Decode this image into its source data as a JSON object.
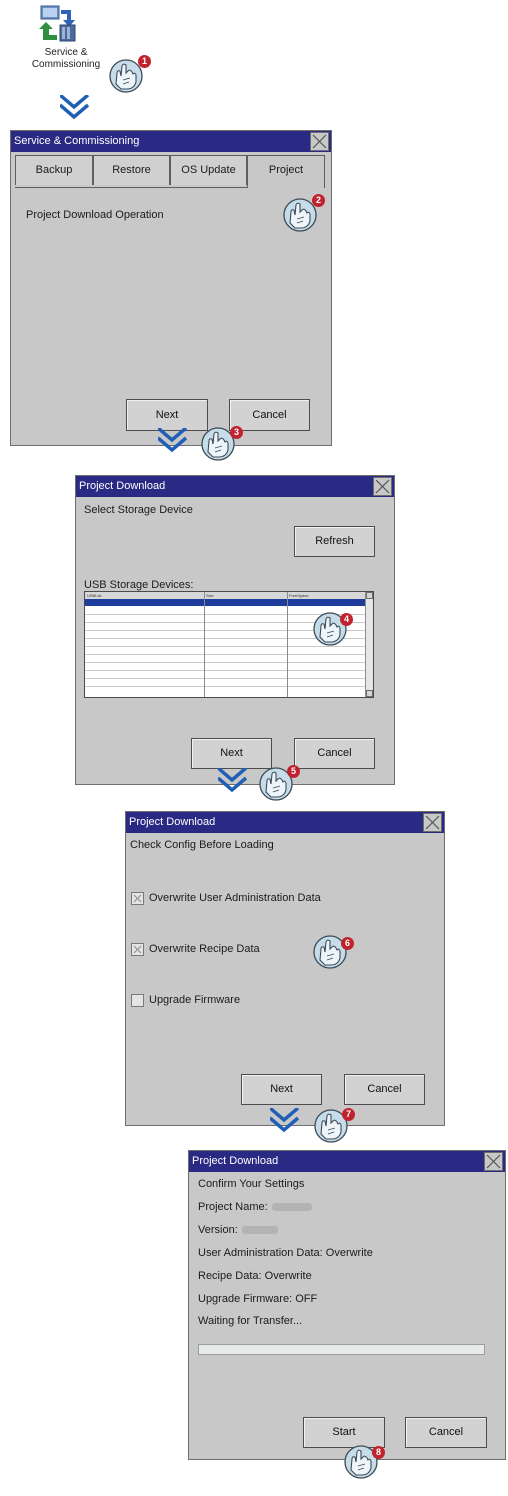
{
  "launcher": {
    "label_line1": "Service &",
    "label_line2": "Commissioning"
  },
  "steps": [
    "1",
    "2",
    "3",
    "4",
    "5",
    "6",
    "7",
    "8"
  ],
  "dialog1": {
    "title": "Service & Commissioning",
    "tabs": [
      "Backup",
      "Restore",
      "OS Update",
      "Project"
    ],
    "body_text": "Project Download Operation",
    "next": "Next",
    "cancel": "Cancel"
  },
  "dialog2": {
    "title": "Project Download",
    "heading": "Select Storage Device",
    "refresh": "Refresh",
    "list_label": "USB Storage Devices:",
    "columns": [
      "USBList",
      "Size",
      "FreeSpace"
    ],
    "next": "Next",
    "cancel": "Cancel"
  },
  "dialog3": {
    "title": "Project Download",
    "heading": "Check Config Before Loading",
    "options": [
      {
        "label": "Overwrite User Administration Data",
        "checked": true
      },
      {
        "label": "Overwrite Recipe Data",
        "checked": true
      },
      {
        "label": "Upgrade Firmware",
        "checked": false
      }
    ],
    "next": "Next",
    "cancel": "Cancel"
  },
  "dialog4": {
    "title": "Project Download",
    "heading": "Confirm Your Settings",
    "project_name_label": "Project Name:",
    "version_label": "Version:",
    "user_admin": "User Administration Data: Overwrite",
    "recipe": "Recipe Data: Overwrite",
    "firmware": "Upgrade Firmware: OFF",
    "waiting": "Waiting for Transfer...",
    "progress": 0,
    "start": "Start",
    "cancel": "Cancel"
  },
  "colors": {
    "titlebar": "#2a2a85",
    "dialog_bg": "#c8c8c8",
    "arrow": "#1f5fb5",
    "badge": "#c0232d",
    "hand_fill": "#c7dce9"
  }
}
